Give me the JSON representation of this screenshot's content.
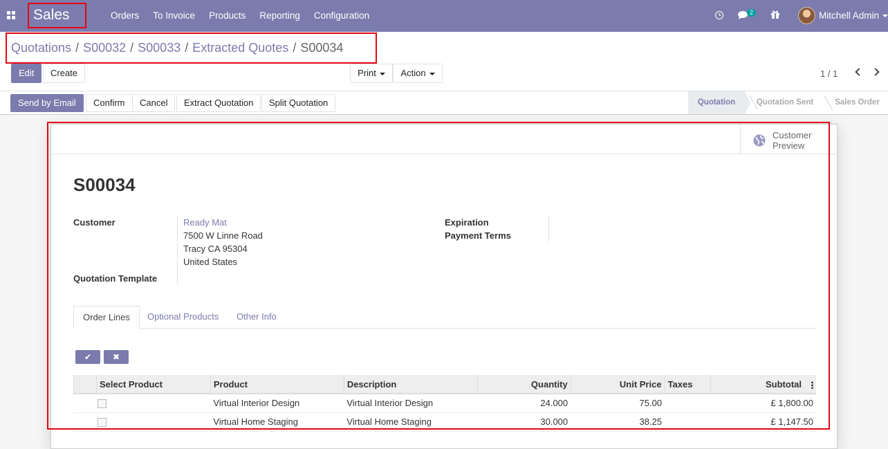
{
  "navbar": {
    "app_name": "Sales",
    "menu": [
      "Orders",
      "To Invoice",
      "Products",
      "Reporting",
      "Configuration"
    ],
    "messages_count": "2",
    "user_name": "Mitchell Admin",
    "icons": [
      "apps-icon",
      "clock-icon",
      "chat-icon",
      "gift-icon"
    ]
  },
  "breadcrumb": {
    "items": [
      "Quotations",
      "S00032",
      "S00033",
      "Extracted Quotes"
    ],
    "current": "S00034"
  },
  "buttons": {
    "edit": "Edit",
    "create": "Create",
    "print": "Print",
    "action": "Action"
  },
  "pager": "1 / 1",
  "statusbar": {
    "actions": [
      "Send by Email",
      "Confirm",
      "Cancel",
      "Extract Quotation",
      "Split Quotation"
    ],
    "stages": [
      "Quotation",
      "Quotation Sent",
      "Sales Order"
    ],
    "current_stage": "Quotation"
  },
  "form": {
    "customer_preview": "Customer Preview",
    "title": "S00034",
    "customer_label": "Customer",
    "customer_name": "Ready Mat",
    "address": [
      "7500 W Linne Road",
      "Tracy CA 95304",
      "United States"
    ],
    "template_label": "Quotation Template",
    "expiration_label": "Expiration",
    "payment_terms_label": "Payment Terms",
    "tabs": [
      "Order Lines",
      "Optional Products",
      "Other Info"
    ],
    "active_tab": "Order Lines",
    "columns": [
      "Select Product",
      "Product",
      "Description",
      "Quantity",
      "Unit Price",
      "Taxes",
      "Subtotal"
    ],
    "lines": [
      {
        "product": "Virtual Interior Design",
        "description": "Virtual Interior Design",
        "quantity": "24.000",
        "unit_price": "75.00",
        "taxes": "",
        "subtotal": "£ 1,800.00"
      },
      {
        "product": "Virtual Home Staging",
        "description": "Virtual Home Staging",
        "quantity": "30.000",
        "unit_price": "38.25",
        "taxes": "",
        "subtotal": "£ 1,147.50"
      }
    ]
  },
  "colors": {
    "primary": "#7c7bad",
    "annotation": "#e30613",
    "badge": "#00a09d"
  }
}
